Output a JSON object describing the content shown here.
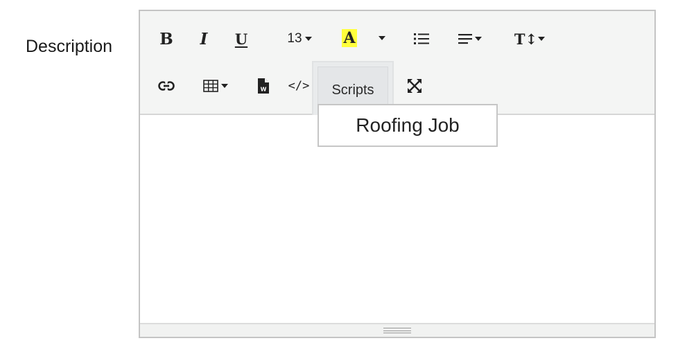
{
  "field": {
    "label": "Description"
  },
  "toolbar": {
    "bold": "B",
    "italic": "I",
    "underline": "U",
    "font_size": "13",
    "color": "A",
    "highlight_color": "#ffff3c",
    "text_size": "T↕",
    "code_view": "</>",
    "scripts": "Scripts"
  },
  "scripts_menu": {
    "items": [
      "Roofing Job"
    ]
  },
  "editor": {
    "content": ""
  }
}
